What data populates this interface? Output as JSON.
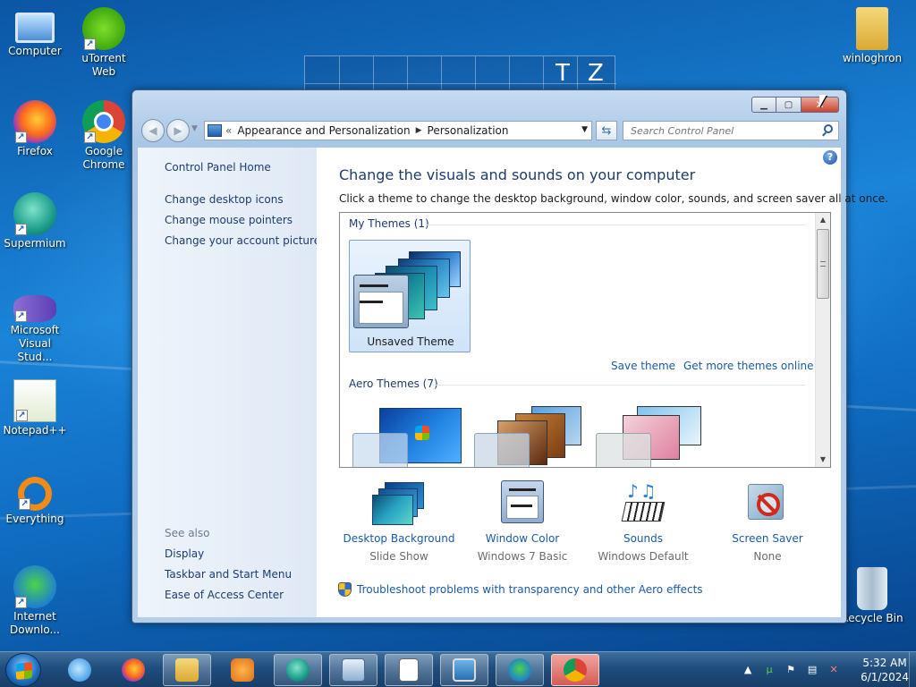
{
  "desktop": {
    "icons": [
      {
        "label": "Computer"
      },
      {
        "label": "uTorrent Web"
      },
      {
        "label": "Firefox"
      },
      {
        "label": "Google Chrome"
      },
      {
        "label": "Supermium"
      },
      {
        "label": "Microsoft Visual Stud..."
      },
      {
        "label": "Notepad++"
      },
      {
        "label": "Everything"
      },
      {
        "label": "Internet Downlo..."
      },
      {
        "label": "winloghron"
      },
      {
        "label": "Recycle Bin"
      }
    ],
    "background_window_text": [
      "T",
      "Z"
    ]
  },
  "window": {
    "address": {
      "overflow": "«",
      "segments": [
        "Appearance and Personalization",
        "Personalization"
      ]
    },
    "search": {
      "placeholder": "Search Control Panel"
    },
    "leftnav": {
      "home": "Control Panel Home",
      "links": [
        "Change desktop icons",
        "Change mouse pointers",
        "Change your account picture"
      ],
      "see_also_header": "See also",
      "see_also": [
        "Display",
        "Taskbar and Start Menu",
        "Ease of Access Center"
      ]
    },
    "content": {
      "help": "?",
      "title": "Change the visuals and sounds on your computer",
      "subtitle": "Click a theme to change the desktop background, window color, sounds, and screen saver all at once.",
      "my_themes_header": "My Themes (1)",
      "unsaved_theme": "Unsaved Theme",
      "save_theme": "Save theme",
      "get_more": "Get more themes online",
      "aero_themes_header": "Aero Themes (7)",
      "options": [
        {
          "label": "Desktop Background",
          "value": "Slide Show",
          "icon": "desktop-background-icon"
        },
        {
          "label": "Window Color",
          "value": "Windows 7 Basic",
          "icon": "window-color-icon"
        },
        {
          "label": "Sounds",
          "value": "Windows Default",
          "icon": "sounds-icon"
        },
        {
          "label": "Screen Saver",
          "value": "None",
          "icon": "screen-saver-icon"
        }
      ],
      "troubleshoot": "Troubleshoot problems with transparency and other Aero effects"
    }
  },
  "taskbar": {
    "clock_time": "5:32 AM",
    "clock_date": "6/1/2024"
  },
  "colors": {
    "accent_link": "#1a5aa8",
    "title_blue": "#1e3b6e",
    "taskbar": "#1f4d7d"
  }
}
